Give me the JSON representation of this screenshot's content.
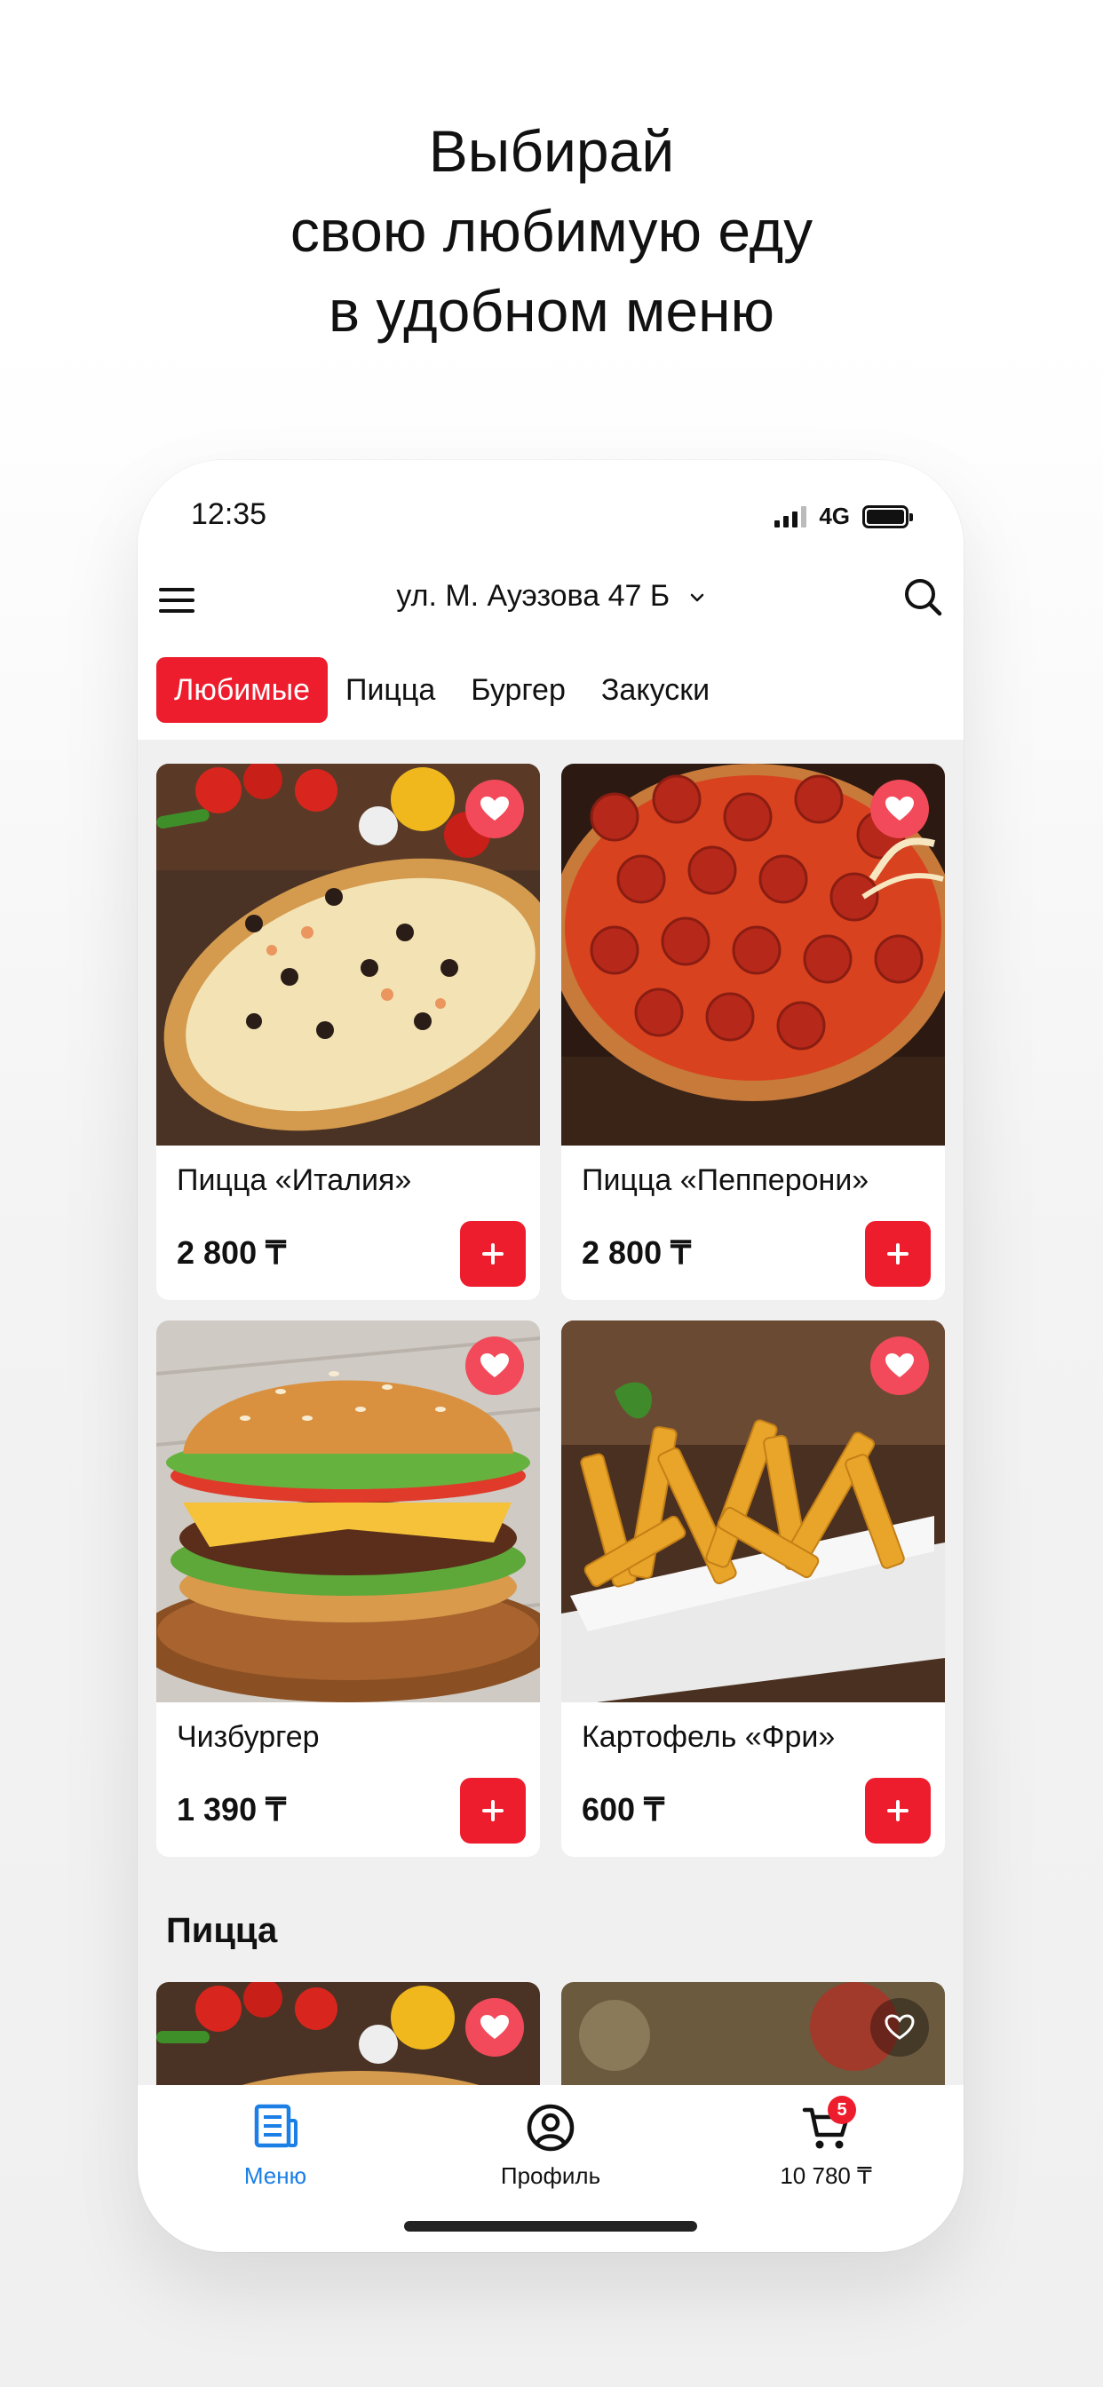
{
  "promo": {
    "line1": "Выбирай",
    "line2": "свою любимую еду",
    "line3": "в удобном меню"
  },
  "status_bar": {
    "time": "12:35",
    "network": "4G",
    "signal_bars": 4,
    "battery_level": 1.0
  },
  "header": {
    "address": "ул. М. Ауэзова 47 Б"
  },
  "tabs": [
    {
      "label": "Любимые",
      "active": true
    },
    {
      "label": "Пицца",
      "active": false
    },
    {
      "label": "Бургер",
      "active": false
    },
    {
      "label": "Закуски",
      "active": false
    }
  ],
  "products": [
    {
      "name": "Пицца «Италия»",
      "price": "2 800 ₸",
      "image": "pizza-italia",
      "favorite": true
    },
    {
      "name": "Пицца «Пепперони»",
      "price": "2 800 ₸",
      "image": "pizza-pepperoni",
      "favorite": true
    },
    {
      "name": "Чизбургер",
      "price": "1 390 ₸",
      "image": "cheeseburger",
      "favorite": true
    },
    {
      "name": "Картофель «Фри»",
      "price": "600 ₸",
      "image": "french-fries",
      "favorite": true
    }
  ],
  "section": {
    "title": "Пицца",
    "preview_items": [
      {
        "image": "pizza-italia",
        "favorite": true
      },
      {
        "image": "pizza-salad",
        "favorite": false
      }
    ]
  },
  "tab_bar": {
    "menu_label": "Меню",
    "profile_label": "Профиль",
    "cart_total": "10 780 ₸",
    "cart_count": "5"
  },
  "colors": {
    "accent": "#ee1d2d",
    "active_tab_text": "#1b7fe6",
    "favorite_badge": "#f24a5a"
  },
  "icons": [
    "menu-icon",
    "chevron-down-icon",
    "search-icon",
    "heart-icon",
    "plus-icon",
    "document-icon",
    "profile-icon",
    "cart-icon"
  ]
}
